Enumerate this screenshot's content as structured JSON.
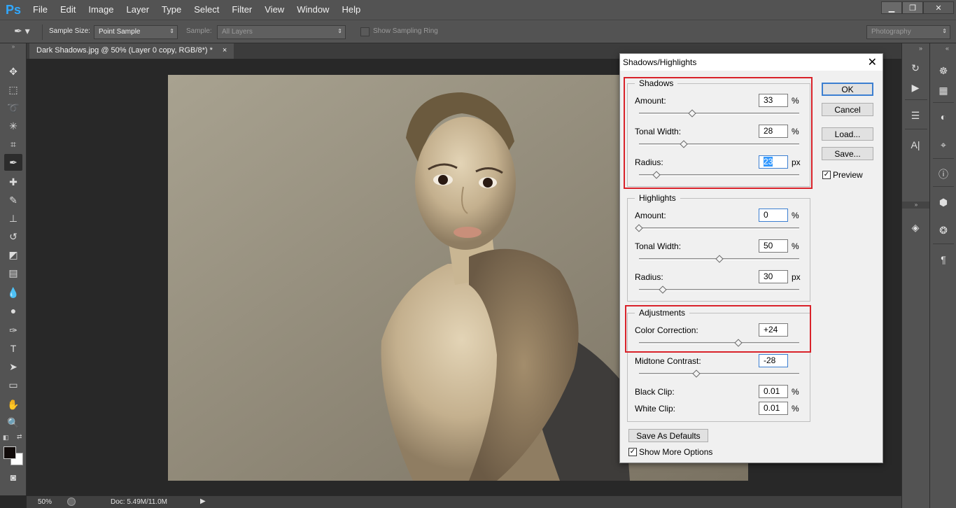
{
  "app": {
    "logo": "Ps"
  },
  "menu": [
    "File",
    "Edit",
    "Image",
    "Layer",
    "Type",
    "Select",
    "Filter",
    "View",
    "Window",
    "Help"
  ],
  "options_bar": {
    "sample_size_label": "Sample Size:",
    "sample_size_value": "Point Sample",
    "sample_label": "Sample:",
    "sample_value": "All Layers",
    "show_ring_label": "Show Sampling Ring",
    "workspace": "Photography"
  },
  "document": {
    "tab_title": "Dark Shadows.jpg @ 50% (Layer 0 copy, RGB/8*) *",
    "tab_close": "×"
  },
  "status": {
    "zoom": "50%",
    "doc_info": "Doc: 5.49M/11.0M"
  },
  "dialog": {
    "title": "Shadows/Highlights",
    "close": "✕",
    "shadows": {
      "title": "Shadows",
      "amount_label": "Amount:",
      "amount": "33",
      "amount_unit": "%",
      "amount_pos": 0.33,
      "tonal_label": "Tonal Width:",
      "tonal": "28",
      "tonal_unit": "%",
      "tonal_pos": 0.28,
      "radius_label": "Radius:",
      "radius": "23",
      "radius_unit": "px",
      "radius_pos": 0.11
    },
    "highlights": {
      "title": "Highlights",
      "amount_label": "Amount:",
      "amount": "0",
      "amount_unit": "%",
      "amount_pos": 0.0,
      "tonal_label": "Tonal Width:",
      "tonal": "50",
      "tonal_unit": "%",
      "tonal_pos": 0.5,
      "radius_label": "Radius:",
      "radius": "30",
      "radius_unit": "px",
      "radius_pos": 0.15
    },
    "adjustments": {
      "title": "Adjustments",
      "color_label": "Color Correction:",
      "color": "+24",
      "color_pos": 0.62,
      "midtone_label": "Midtone Contrast:",
      "midtone": "-28",
      "midtone_pos": 0.36,
      "black_label": "Black Clip:",
      "black": "0.01",
      "black_unit": "%",
      "white_label": "White Clip:",
      "white": "0.01",
      "white_unit": "%"
    },
    "buttons": {
      "ok": "OK",
      "cancel": "Cancel",
      "load": "Load...",
      "save": "Save...",
      "save_defaults": "Save As Defaults"
    },
    "preview_label": "Preview",
    "show_more_label": "Show More Options"
  },
  "colors": {
    "brand": "#31a8ff",
    "highlight_box": "#d9222a",
    "focus": "#3c7fd1"
  }
}
